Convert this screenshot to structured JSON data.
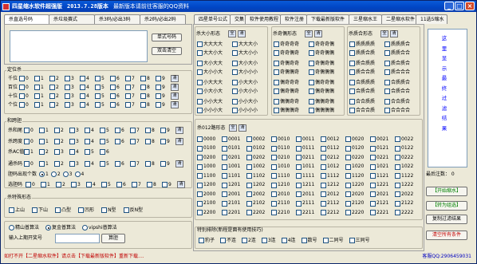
{
  "window": {
    "title": "四星缩水软件超强版",
    "version": "2013.7.28版本",
    "tip": "最新版本请前往客服的QQ资料",
    "min": "_",
    "max": "□",
    "close": "×"
  },
  "left_tabs": [
    "杀直选号码",
    "杀垃圾赛式",
    "杀3码/必出3码",
    "杀2码/必出2码"
  ],
  "right_tabs": [
    "四星单号公式",
    "交集",
    "软件使用教程",
    "软件注册",
    "下载最新版软件",
    "三星缩水王",
    "二星缩水软件",
    "11选5缩水"
  ],
  "input_panel": {
    "single_button": "单式号码",
    "clear_button": "双击清空"
  },
  "position_group": {
    "title": "定位杀",
    "rows": [
      {
        "label": "千位"
      },
      {
        "label": "百位"
      },
      {
        "label": "十位"
      },
      {
        "label": "个位"
      }
    ],
    "digits": [
      "0",
      "1",
      "2",
      "3",
      "4",
      "5",
      "6",
      "7",
      "8",
      "9"
    ],
    "clear": "清"
  },
  "sum_group": {
    "title": "和跨胆",
    "rows": [
      {
        "label": "杀和尾",
        "digits": [
          "0",
          "1",
          "2",
          "3",
          "4",
          "5",
          "6",
          "7",
          "8",
          "9"
        ]
      },
      {
        "label": "杀跨度",
        "digits": [
          "0",
          "1",
          "2",
          "3",
          "4",
          "5",
          "6",
          "7",
          "8",
          "9"
        ]
      },
      {
        "label": "杀AC值",
        "digits": [
          "1",
          "2",
          "3",
          "4",
          "5",
          "6"
        ]
      },
      {
        "label": "通杀码",
        "digits": [
          "0",
          "1",
          "2",
          "3",
          "4",
          "5",
          "6",
          "7",
          "8",
          "9"
        ]
      }
    ],
    "dan_label": "胆码出现个数",
    "dan_options": [
      "1",
      "2",
      "3",
      "4"
    ],
    "dan_selected": "1",
    "xuan_label": "选胆码",
    "clear": "清"
  },
  "special_group": {
    "title": "杀特殊形态",
    "items": [
      "上山",
      "下山",
      "凸型",
      "凹形",
      "N型",
      "反N型"
    ]
  },
  "filter_group": {
    "options": [
      "精山普算法",
      "复金普算法",
      "vipshi普算法"
    ],
    "selected_index": 1,
    "period_label": "输入上期开奖号",
    "calc_button": "算胆"
  },
  "size_group": {
    "title": "杀大小形态",
    "all": "全",
    "clear": "清",
    "items": [
      [
        "大大大大",
        "大大大小"
      ],
      [
        "大大小大",
        "大大小小"
      ],
      [
        "大小大大",
        "大小大小"
      ],
      [
        "大小小大",
        "大小小小"
      ],
      [
        "小大大大",
        "小大大小"
      ],
      [
        "小大小大",
        "小大小小"
      ],
      [
        "小小大大",
        "小小大小"
      ],
      [
        "小小小大",
        "小小小小"
      ]
    ]
  },
  "odd_group": {
    "title": "杀奇偶形态",
    "all": "全",
    "clear": "清",
    "items": [
      [
        "奇奇奇奇",
        "奇奇奇偶"
      ],
      [
        "奇奇偶奇",
        "奇奇偶偶"
      ],
      [
        "奇偶奇奇",
        "奇偶奇偶"
      ],
      [
        "奇偶偶奇",
        "奇偶偶偶"
      ],
      [
        "偶奇奇奇",
        "偶奇奇偶"
      ],
      [
        "偶奇偶奇",
        "偶奇偶偶"
      ],
      [
        "偶偶奇奇",
        "偶偶奇偶"
      ],
      [
        "偶偶偶奇",
        "偶偶偶偶"
      ]
    ]
  },
  "prime_group": {
    "title": "杀质合形态",
    "all": "全",
    "clear": "清",
    "items": [
      [
        "质质质质",
        "质质质合"
      ],
      [
        "质质合质",
        "质质合合"
      ],
      [
        "质合质质",
        "质合质合"
      ],
      [
        "质合合质",
        "质合合合"
      ],
      [
        "合质质质",
        "合质质合"
      ],
      [
        "合质合质",
        "合质合合"
      ],
      [
        "合合质质",
        "合合质合"
      ],
      [
        "合合合质",
        "合合合合"
      ]
    ]
  },
  "road_group": {
    "title": "杀012路形态",
    "all": "全",
    "clear": "清",
    "rows": [
      [
        "0000",
        "0001",
        "0002",
        "0010",
        "0011",
        "0012",
        "0020",
        "0021",
        "0022"
      ],
      [
        "0100",
        "0101",
        "0102",
        "0110",
        "0111",
        "0112",
        "0120",
        "0121",
        "0122"
      ],
      [
        "0200",
        "0201",
        "0202",
        "0210",
        "0211",
        "0212",
        "0220",
        "0221",
        "0222"
      ],
      [
        "1000",
        "1001",
        "1002",
        "1010",
        "1011",
        "1012",
        "1020",
        "1021",
        "1022"
      ],
      [
        "1100",
        "1101",
        "1102",
        "1110",
        "1111",
        "1112",
        "1120",
        "1121",
        "1122"
      ],
      [
        "1200",
        "1201",
        "1202",
        "1210",
        "1211",
        "1212",
        "1220",
        "1221",
        "1222"
      ],
      [
        "2000",
        "2001",
        "2002",
        "2010",
        "2011",
        "2012",
        "2020",
        "2021",
        "2022"
      ],
      [
        "2100",
        "2101",
        "2102",
        "2110",
        "2111",
        "2112",
        "2120",
        "2121",
        "2122"
      ],
      [
        "2200",
        "2201",
        "2202",
        "2210",
        "2211",
        "2212",
        "2220",
        "2221",
        "2222"
      ]
    ]
  },
  "rule_group": {
    "title": "特别排除(新程是面有使用技巧)",
    "items": [
      "豹子",
      "不连",
      "2连",
      "3连",
      "4连",
      "数号",
      "二同号",
      "三同号"
    ]
  },
  "right_panel": {
    "vertical_text": [
      "这",
      "里",
      "显",
      "示",
      "最",
      "终",
      "过",
      "滤",
      "结",
      "果"
    ],
    "count_label": "最后注数： 0",
    "start_button": "【开始缩水】",
    "transfer_button": "【转为组选】",
    "copy_button": "复制过滤结果",
    "clear_button": "清空所有条件"
  },
  "status": {
    "left": "如打不开【二星缩水软件】请点击【下载最新版软件】重新下载....",
    "right": "客服QQ:2906459031"
  },
  "colors": {
    "title_bar": "#0a5ad8",
    "status_red": "#c00000",
    "result_blue": "#0000ff",
    "start_green": "#008000"
  }
}
